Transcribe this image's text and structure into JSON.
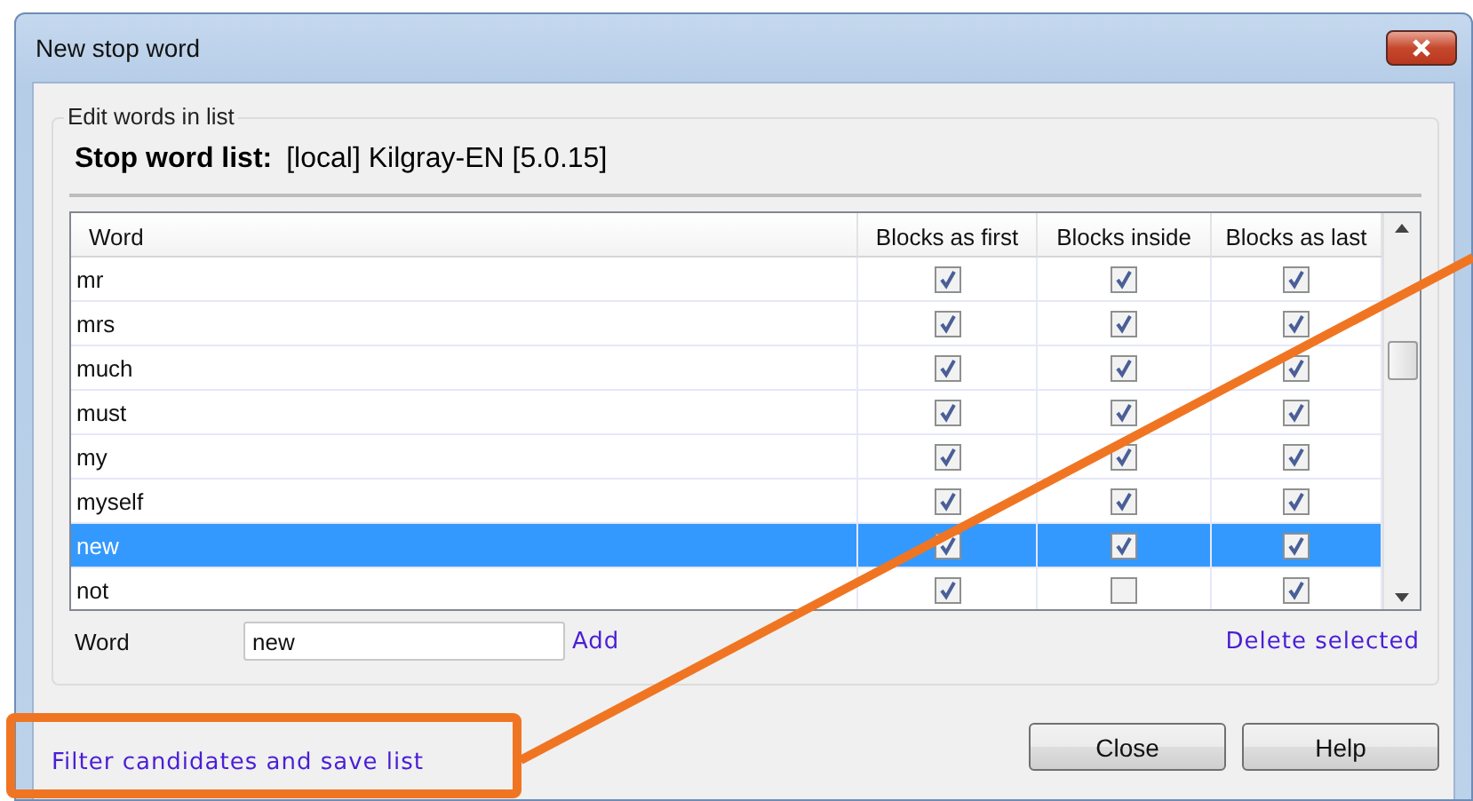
{
  "window": {
    "title": "New stop word"
  },
  "edit_group": {
    "legend": "Edit words in list",
    "list_label": "Stop word list:",
    "list_name": "[local] Kilgray-EN [5.0.15]"
  },
  "table": {
    "columns": [
      "Word",
      "Blocks as first",
      "Blocks inside",
      "Blocks as last"
    ],
    "rows": [
      {
        "word": "mr",
        "first": true,
        "inside": true,
        "last": true,
        "selected": false
      },
      {
        "word": "mrs",
        "first": true,
        "inside": true,
        "last": true,
        "selected": false
      },
      {
        "word": "much",
        "first": true,
        "inside": true,
        "last": true,
        "selected": false
      },
      {
        "word": "must",
        "first": true,
        "inside": true,
        "last": true,
        "selected": false
      },
      {
        "word": "my",
        "first": true,
        "inside": true,
        "last": true,
        "selected": false
      },
      {
        "word": "myself",
        "first": true,
        "inside": true,
        "last": true,
        "selected": false
      },
      {
        "word": "new",
        "first": true,
        "inside": true,
        "last": true,
        "selected": true
      },
      {
        "word": "not",
        "first": true,
        "inside": false,
        "last": true,
        "selected": false
      }
    ]
  },
  "word_field": {
    "label": "Word",
    "value": "new",
    "add_link": "Add",
    "delete_link": "Delete selected"
  },
  "save_group": {
    "link": "Filter candidates and save list"
  },
  "buttons": [
    "Close",
    "Help"
  ]
}
